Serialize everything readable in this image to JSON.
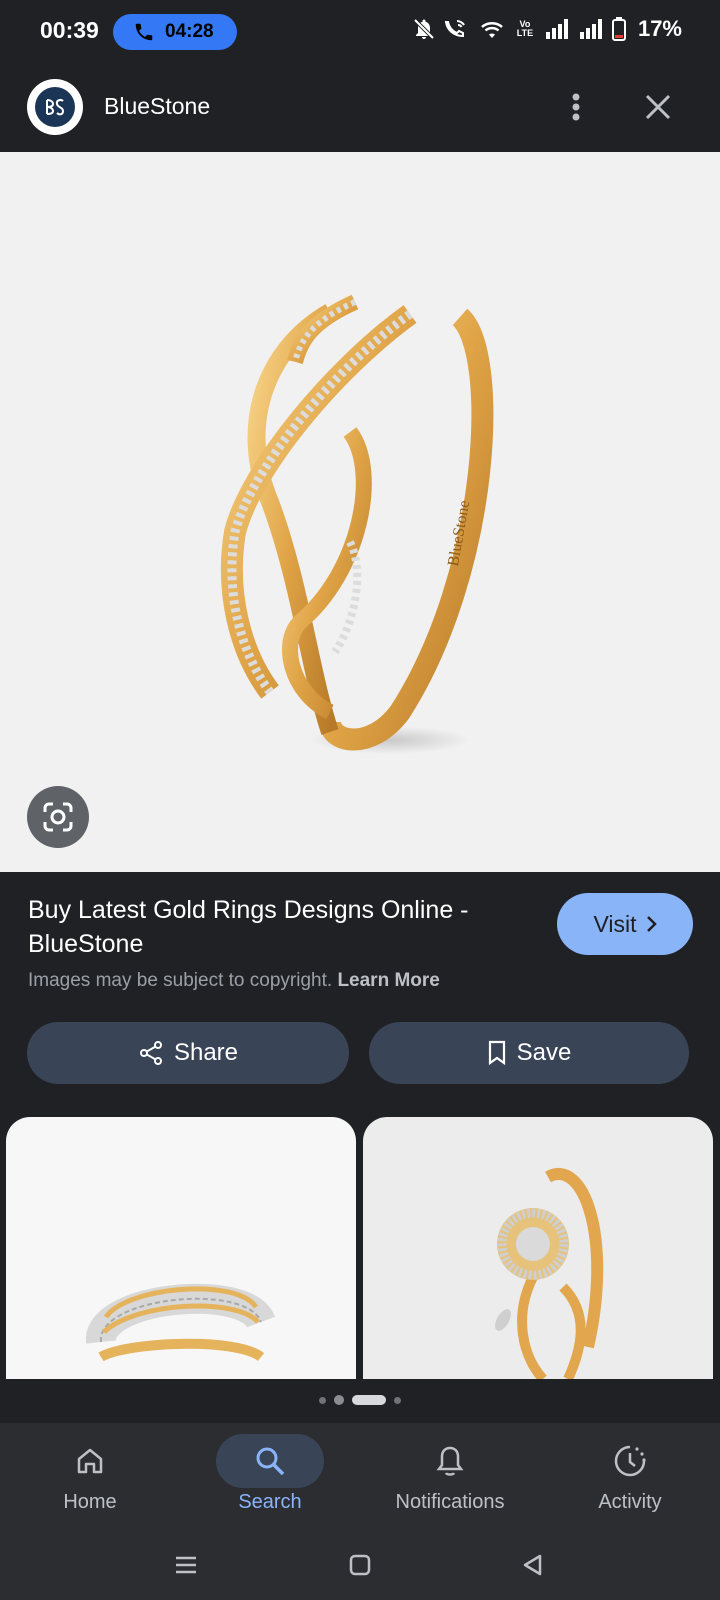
{
  "status_bar": {
    "time": "00:39",
    "call_timer": "04:28",
    "volte_label": "Vo LTE",
    "battery_percent": "17%"
  },
  "header": {
    "site_name": "BlueStone"
  },
  "main_image": {
    "engraving": "BlueStone"
  },
  "result": {
    "title": "Buy Latest Gold Rings Designs Online - BlueStone",
    "visit_label": "Visit",
    "copyright_text": "Images may be subject to copyright.",
    "learn_more": "Learn More"
  },
  "actions": {
    "share_label": "Share",
    "save_label": "Save"
  },
  "pager": {
    "count": 4,
    "active_index": 2
  },
  "bottom_nav": {
    "items": [
      {
        "label": "Home",
        "icon": "home-icon"
      },
      {
        "label": "Search",
        "icon": "search-icon"
      },
      {
        "label": "Notifications",
        "icon": "bell-icon"
      },
      {
        "label": "Activity",
        "icon": "activity-icon"
      }
    ],
    "active": "Search"
  },
  "colors": {
    "background": "#202124",
    "accent": "#8ab4f8",
    "call_pill": "#3478f6",
    "pill_button": "#394457",
    "nav_bar": "#2b2d31"
  }
}
